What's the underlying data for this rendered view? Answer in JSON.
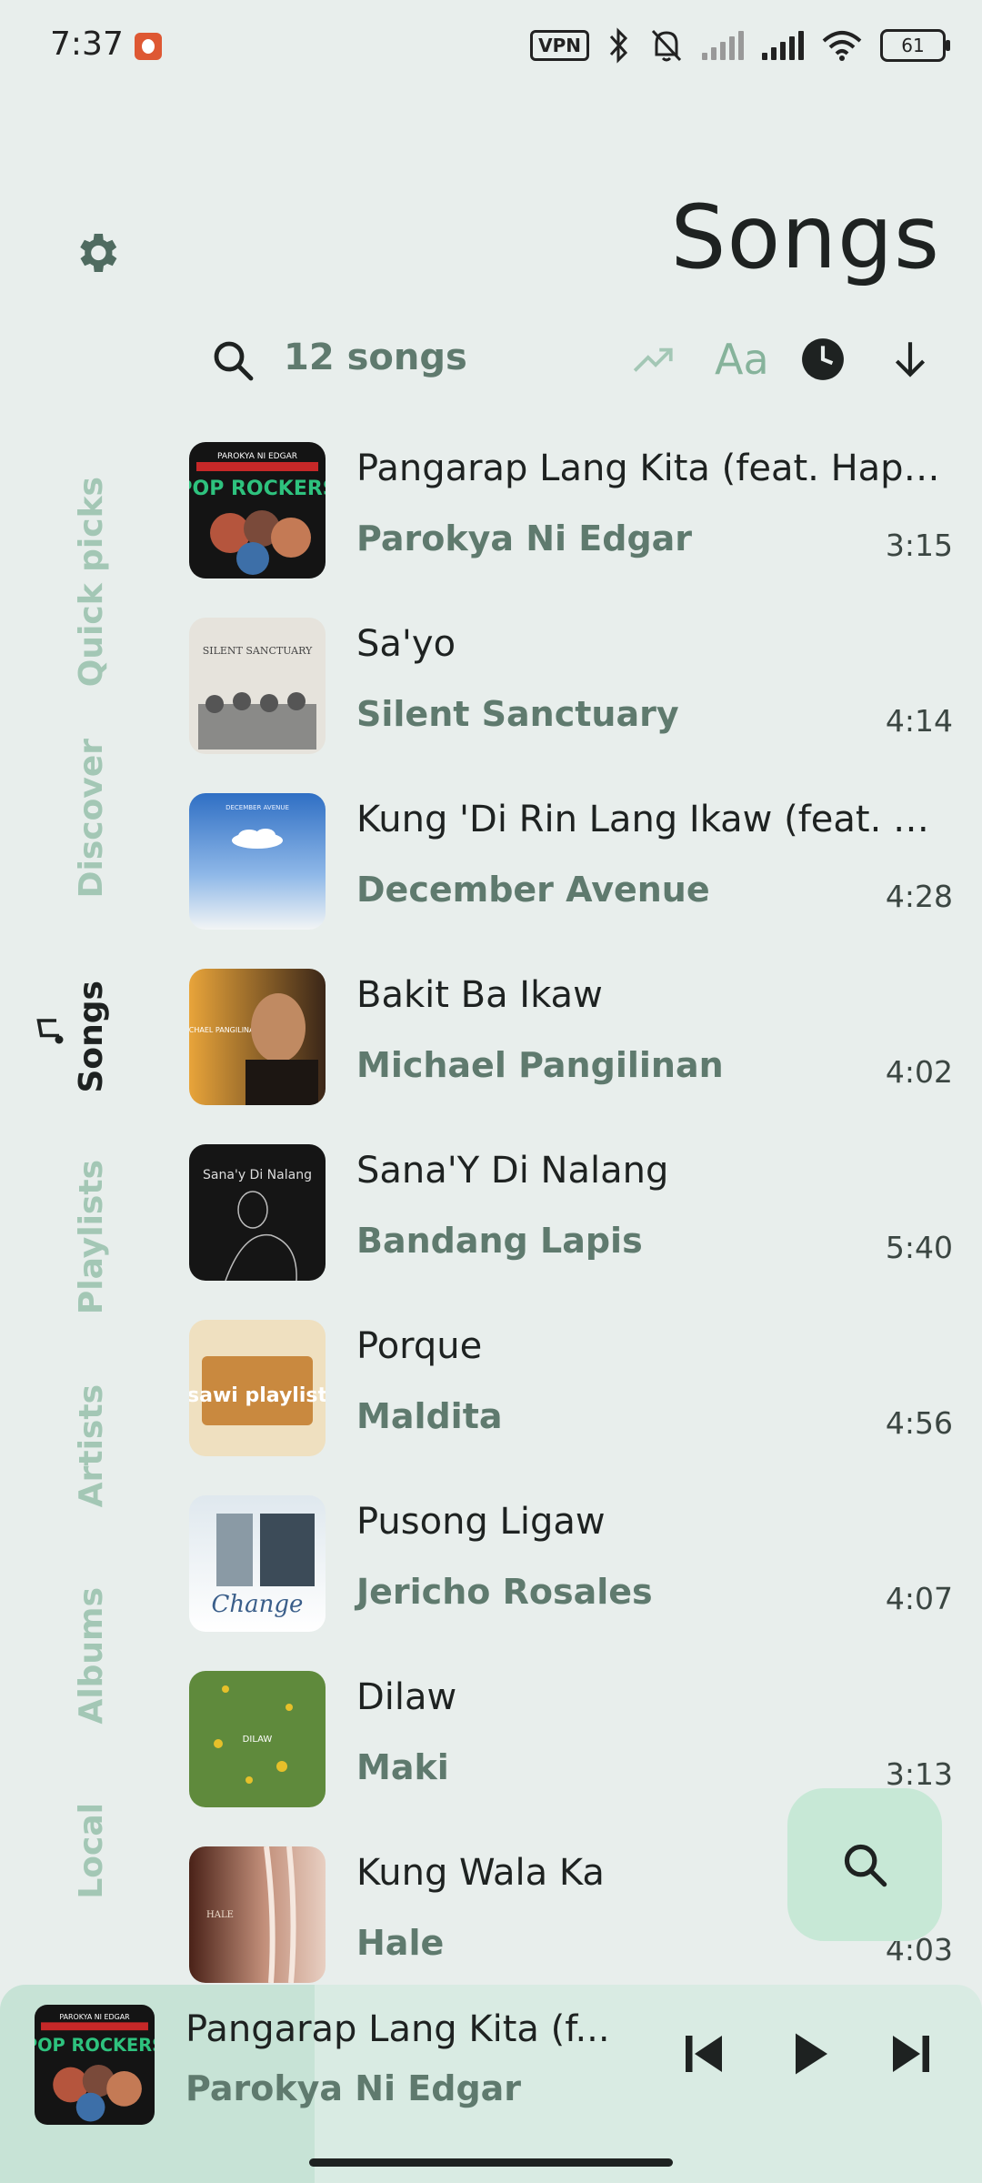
{
  "status_bar": {
    "time": "7:37",
    "vpn_label": "VPN",
    "battery": "61",
    "icons": [
      "duckduckgo-icon",
      "vpn-icon",
      "bluetooth-icon",
      "bell-off-icon",
      "signal-icon",
      "signal-icon",
      "wifi-icon",
      "battery-icon"
    ]
  },
  "header": {
    "title": "Songs",
    "settings_icon": "gear-icon"
  },
  "toolbar": {
    "search_icon": "search-icon",
    "count": "12 songs",
    "sort_trending_icon": "trending-up-icon",
    "sort_alpha_label": "Aa",
    "sort_time_icon": "clock-icon",
    "sort_direction_icon": "arrow-down-icon"
  },
  "sidebar": {
    "items": [
      {
        "label": "Quick picks",
        "active": false
      },
      {
        "label": "Discover",
        "active": false
      },
      {
        "label": "Songs",
        "active": true
      },
      {
        "label": "Playlists",
        "active": false
      },
      {
        "label": "Artists",
        "active": false
      },
      {
        "label": "Albums",
        "active": false
      },
      {
        "label": "Local",
        "active": false
      }
    ]
  },
  "songs": [
    {
      "title": "Pangarap Lang Kita (feat. Happ...",
      "artist": "Parokya Ni Edgar",
      "duration": "3:15",
      "art_caption": "POP ROCKERS"
    },
    {
      "title": "Sa'yo",
      "artist": "Silent Sanctuary",
      "duration": "4:14",
      "art_caption": "SILENT SANCTUARY"
    },
    {
      "title": "Kung 'Di Rin Lang Ikaw (feat. Moi...",
      "artist": "December Avenue",
      "duration": "4:28",
      "art_caption": "DECEMBER AVENUE"
    },
    {
      "title": "Bakit Ba Ikaw",
      "artist": "Michael Pangilinan",
      "duration": "4:02",
      "art_caption": "MICHAEL PANGILINAN"
    },
    {
      "title": "Sana'Y Di Nalang",
      "artist": "Bandang Lapis",
      "duration": "5:40",
      "art_caption": "Sana'y Di Nalang"
    },
    {
      "title": "Porque",
      "artist": "Maldita",
      "duration": "4:56",
      "art_caption": "sawi playlist"
    },
    {
      "title": "Pusong Ligaw",
      "artist": "Jericho Rosales",
      "duration": "4:07",
      "art_caption": "Change"
    },
    {
      "title": "Dilaw",
      "artist": "Maki",
      "duration": "3:13",
      "art_caption": "DILAW"
    },
    {
      "title": "Kung Wala Ka",
      "artist": "Hale",
      "duration": "4:03",
      "art_caption": "HALE"
    }
  ],
  "fab": {
    "icon": "search-icon"
  },
  "player": {
    "title": "Pangarap Lang Kita (f...",
    "artist": "Parokya Ni Edgar",
    "progress": 0.32,
    "controls": [
      "skip-previous-icon",
      "play-icon",
      "skip-next-icon"
    ]
  },
  "colors": {
    "background": "#e8eeec",
    "accent": "#5f7a6e",
    "nav_inactive": "#a3c7b5",
    "fab": "#c7e8d6"
  }
}
